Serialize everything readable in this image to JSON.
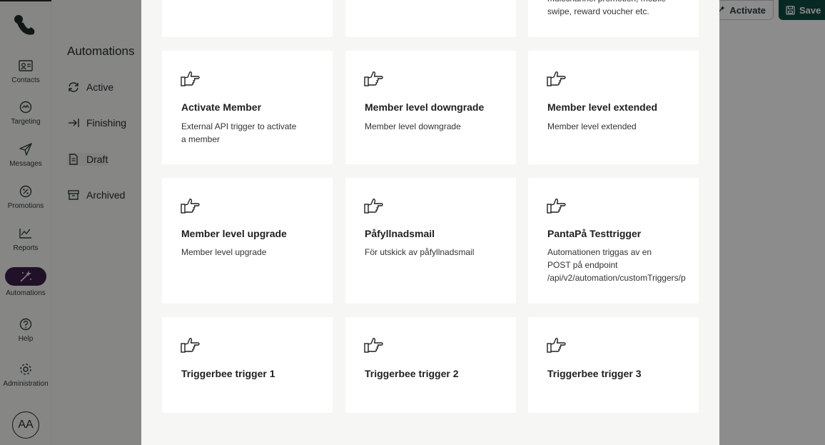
{
  "rail": {
    "items": [
      {
        "label": "Contacts",
        "icon": "contacts-icon"
      },
      {
        "label": "Targeting",
        "icon": "targeting-icon"
      },
      {
        "label": "Messages",
        "icon": "messages-icon"
      },
      {
        "label": "Promotions",
        "icon": "promotions-icon"
      },
      {
        "label": "Reports",
        "icon": "reports-icon"
      },
      {
        "label": "Automations",
        "icon": "automations-icon"
      },
      {
        "label": "Help",
        "icon": "help-icon"
      },
      {
        "label": "Administration",
        "icon": "administration-icon"
      }
    ],
    "avatar": "AA"
  },
  "subnav": {
    "title": "Automations",
    "items": [
      {
        "label": "Active",
        "icon": "refresh-icon"
      },
      {
        "label": "Finishing",
        "icon": "arrow-to-line-icon"
      },
      {
        "label": "Draft",
        "icon": "document-icon"
      },
      {
        "label": "Archived",
        "icon": "archive-icon"
      }
    ]
  },
  "toolbar": {
    "activate_label": "Activate",
    "save_label": "Save"
  },
  "modal": {
    "top_row_partial_desc": "multichannel promotion, mobile\nswipe, reward voucher etc.",
    "cards": [
      {
        "title": "Activate Member",
        "desc": "External API trigger to activate\na member",
        "icon": "pointing-hand-icon"
      },
      {
        "title": "Member level downgrade",
        "desc": "Member level downgrade",
        "icon": "pointing-hand-icon"
      },
      {
        "title": "Member level extended",
        "desc": "Member level extended",
        "icon": "pointing-hand-icon"
      },
      {
        "title": "Member level upgrade",
        "desc": "Member level upgrade",
        "icon": "pointing-hand-icon"
      },
      {
        "title": "Påfyllnadsmail",
        "desc": "För utskick av påfyllnadsmail",
        "icon": "pointing-hand-icon"
      },
      {
        "title": "PantaPå Testtrigger",
        "desc": "Automationen triggas av en\nPOST på endpoint\n/api/v2/automation/customTriggers/p",
        "icon": "pointing-hand-icon"
      },
      {
        "title": "Triggerbee trigger 1",
        "desc": "",
        "icon": "pointing-hand-icon"
      },
      {
        "title": "Triggerbee trigger 2",
        "desc": "",
        "icon": "pointing-hand-icon"
      },
      {
        "title": "Triggerbee trigger 3",
        "desc": "",
        "icon": "pointing-hand-icon"
      }
    ]
  },
  "colors": {
    "brand_dark": "#1f2a2a",
    "save_green": "#0f4a41",
    "automations_active": "#3b1f4a"
  }
}
